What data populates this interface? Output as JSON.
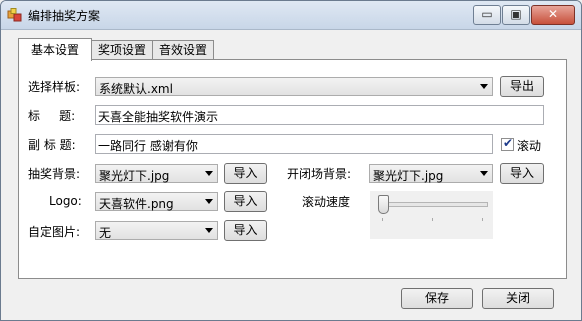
{
  "window": {
    "title": "编排抽奖方案",
    "controls": {
      "minimize": "▭",
      "maximize": "▣",
      "close": "✕"
    }
  },
  "tabs": [
    {
      "label": "基本设置",
      "active": true
    },
    {
      "label": "奖项设置",
      "active": false
    },
    {
      "label": "音效设置",
      "active": false
    }
  ],
  "form": {
    "template_label": "选择样板:",
    "template_value": "系统默认.xml",
    "export_button": "导出",
    "title_label": "标     题:",
    "title_value": "天喜全能抽奖软件演示",
    "subtitle_label": "副 标 题:",
    "subtitle_value": "一路同行 感谢有你",
    "scroll_label": "滚动",
    "scroll_checked": true,
    "checkmark": "✔",
    "draw_bg_label": "抽奖背景:",
    "draw_bg_value": "聚光灯下.jpg",
    "open_bg_label": "开闭场背景:",
    "open_bg_value": "聚光灯下.jpg",
    "logo_label": "Logo:",
    "logo_value": "天喜软件.png",
    "custom_img_label": "自定图片:",
    "custom_img_value": "无",
    "import_button": "导入",
    "speed_label": "滚动速度"
  },
  "footer": {
    "save_button": "保存",
    "close_button": "关闭"
  },
  "colors": {
    "close_button_red": "#c7503b",
    "panel_white": "#ffffff",
    "window_bg": "#f0f0f0"
  }
}
